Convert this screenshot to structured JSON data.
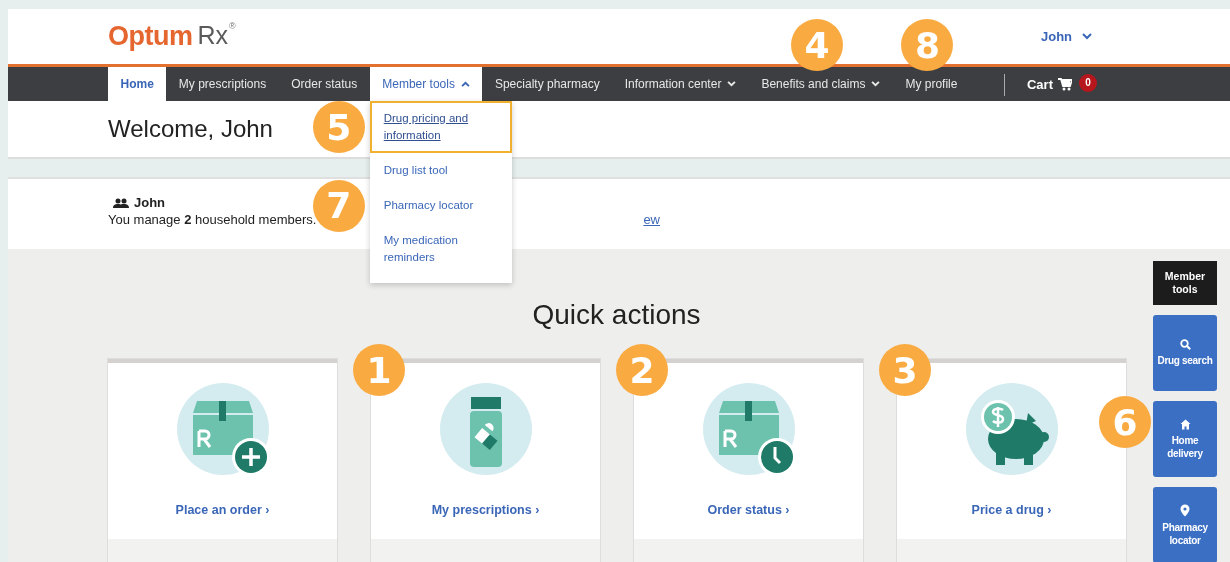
{
  "logo": {
    "brand": "Optum",
    "product": "Rx",
    "mark": "®"
  },
  "user_menu": {
    "label": "John",
    "expanded": false
  },
  "nav": [
    {
      "label": "Home",
      "selected": true
    },
    {
      "label": "My prescriptions",
      "selected": false
    },
    {
      "label": "Order status",
      "selected": false
    },
    {
      "label": "Member tools",
      "selected": false,
      "menu": true,
      "expanded": true
    },
    {
      "label": "Specialty pharmacy",
      "selected": false
    },
    {
      "label": "Information center",
      "selected": false,
      "menu": true,
      "expanded": false
    },
    {
      "label": "Benefits and claims",
      "selected": false,
      "menu": true,
      "expanded": false,
      "callout": "4"
    },
    {
      "label": "My profile",
      "selected": false,
      "callout": "8"
    }
  ],
  "cart": {
    "label": "Cart",
    "count": "0"
  },
  "dropdown": [
    {
      "label": "Drug pricing and information",
      "selected": true,
      "callout": "5"
    },
    {
      "label": "Drug list tool",
      "selected": false
    },
    {
      "label": "Pharmacy locator",
      "selected": false,
      "callout": "7"
    },
    {
      "label": "My medication reminders",
      "selected": false
    }
  ],
  "welcome": "Welcome, John",
  "household": {
    "name": "John",
    "text": "You manage **2** household members.",
    "link_end": "ew"
  },
  "quick_actions": {
    "title": "Quick actions",
    "cards": [
      {
        "kind": "box-plus",
        "label": "Place an order ›"
      },
      {
        "kind": "bottle",
        "label": "My prescriptions ›",
        "callout": "1"
      },
      {
        "kind": "box-clock",
        "label": "Order status ›",
        "callout": "2"
      },
      {
        "kind": "piggy",
        "label": "Price a drug ›",
        "callout": "3"
      }
    ]
  },
  "side_tools": {
    "title": "Member tools",
    "buttons": [
      {
        "kind": "search",
        "label": "Drug search"
      },
      {
        "kind": "home",
        "label": "Home delivery",
        "callout": "6"
      },
      {
        "kind": "pin",
        "label": "Pharmacy locator"
      }
    ]
  }
}
